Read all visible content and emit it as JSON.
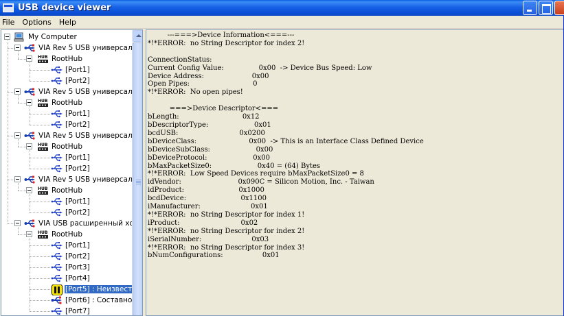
{
  "window": {
    "title": "USB device viewer"
  },
  "menu": [
    "File",
    "Options",
    "Help"
  ],
  "icons": {
    "app": "window-icon",
    "computer": "computer-icon",
    "controller": "usb-plug-icon",
    "hub": "hub-icon",
    "port": "usb-trident-icon",
    "unknown_device": "warning-device-icon",
    "composite_device": "usb-plug-icon"
  },
  "tree": {
    "root": "My Computer",
    "controllers": [
      {
        "label": "VIA Rev 5 USB универсал",
        "hub": "RootHub",
        "ports": [
          "[Port1]",
          "[Port2]"
        ]
      },
      {
        "label": "VIA Rev 5 USB универсал",
        "hub": "RootHub",
        "ports": [
          "[Port1]",
          "[Port2]"
        ]
      },
      {
        "label": "VIA Rev 5 USB универсал",
        "hub": "RootHub",
        "ports": [
          "[Port1]",
          "[Port2]"
        ]
      },
      {
        "label": "VIA Rev 5 USB универсал",
        "hub": "RootHub",
        "ports": [
          "[Port1]",
          "[Port2]"
        ]
      },
      {
        "label": "VIA USB расширенный хо",
        "hub": "RootHub",
        "ports": [
          "[Port1]",
          "[Port2]",
          "[Port3]",
          "[Port4]",
          "[Port5]  :  Неизвест",
          "[Port6]  :  Составно",
          "[Port7]"
        ],
        "selected_port_index": 4
      }
    ]
  },
  "details": [
    "         ---===>Device Information<===---",
    "*!*ERROR:  no String Descriptor for index 2!",
    "",
    "ConnectionStatus:",
    "Current Config Value:                0x00  -> Device Bus Speed: Low",
    "Device Address:                      0x00",
    "Open Pipes:                             0",
    "*!*ERROR:  No open pipes!",
    "",
    "          ===>Device Descriptor<===",
    "bLength:                             0x12",
    "bDescriptorType:                     0x01",
    "bcdUSB:                            0x0200",
    "bDeviceClass:                        0x00  -> This is an Interface Class Defined Device",
    "bDeviceSubClass:                     0x00",
    "bDeviceProtocol:                     0x00",
    "bMaxPacketSize0:                     0x40 = (64) Bytes",
    "*!*ERROR:  Low Speed Devices require bMaxPacketSize0 = 8",
    "idVendor:                          0x090C = Silicon Motion, Inc. - Taiwan",
    "idProduct:                         0x1000",
    "bcdDevice:                         0x1100",
    "iManufacturer:                       0x01",
    "*!*ERROR:  no String Descriptor for index 1!",
    "iProduct:                            0x02",
    "*!*ERROR:  no String Descriptor for index 2!",
    "iSerialNumber:                       0x03",
    "*!*ERROR:  no String Descriptor for index 3!",
    "bNumConfigurations:                  0x01"
  ]
}
